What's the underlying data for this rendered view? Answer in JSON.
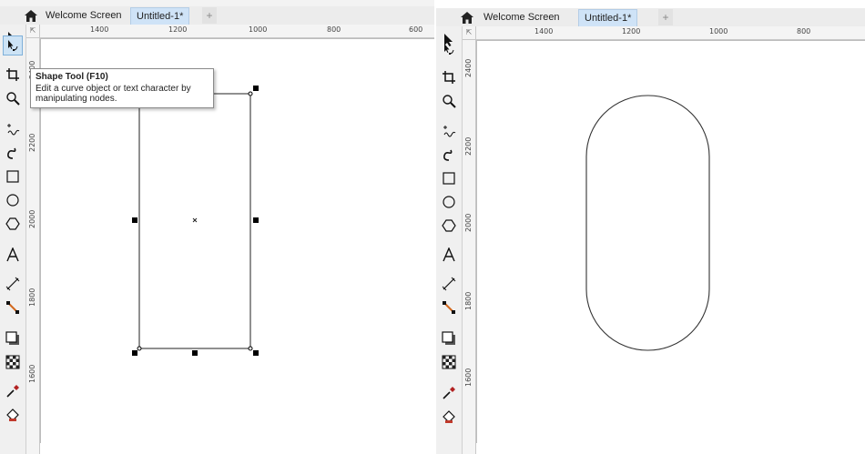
{
  "left": {
    "tabs": {
      "welcome": "Welcome Screen",
      "document": "Untitled-1*",
      "new_tab": "+"
    },
    "ruler": {
      "h_labels": [
        "1400",
        "1200",
        "1000",
        "800",
        "600"
      ],
      "v_labels": [
        "2400",
        "2200",
        "2000",
        "1800",
        "1600"
      ]
    },
    "tooltip": {
      "title": "Shape Tool (F10)",
      "line1": "Edit a curve object or text character by",
      "line2": "manipulating nodes."
    }
  },
  "right": {
    "tabs": {
      "welcome": "Welcome Screen",
      "document": "Untitled-1*",
      "new_tab": "+"
    },
    "ruler": {
      "h_labels": [
        "1400",
        "1200",
        "1000",
        "800"
      ],
      "v_labels": [
        "2400",
        "2200",
        "2000",
        "1800",
        "1600"
      ]
    }
  },
  "tools": [
    {
      "icon": "pick-tool-icon"
    },
    {
      "icon": "shape-tool-icon"
    },
    {
      "icon": "crop-tool-icon"
    },
    {
      "icon": "zoom-tool-icon"
    },
    {
      "icon": "freehand-tool-icon"
    },
    {
      "icon": "artistic-media-tool-icon"
    },
    {
      "icon": "rectangle-tool-icon"
    },
    {
      "icon": "ellipse-tool-icon"
    },
    {
      "icon": "polygon-tool-icon"
    },
    {
      "icon": "text-tool-icon"
    },
    {
      "icon": "dimension-tool-icon"
    },
    {
      "icon": "connector-tool-icon"
    },
    {
      "icon": "drop-shadow-tool-icon"
    },
    {
      "icon": "transparency-tool-icon"
    },
    {
      "icon": "eyedropper-tool-icon"
    },
    {
      "icon": "interactive-fill-tool-icon"
    }
  ],
  "colors": {
    "active_tab": "#cfe3f7",
    "selected_tool": "#cde3f5",
    "ruler": "#f4f4f4",
    "toolbox": "#f0f0f0"
  }
}
